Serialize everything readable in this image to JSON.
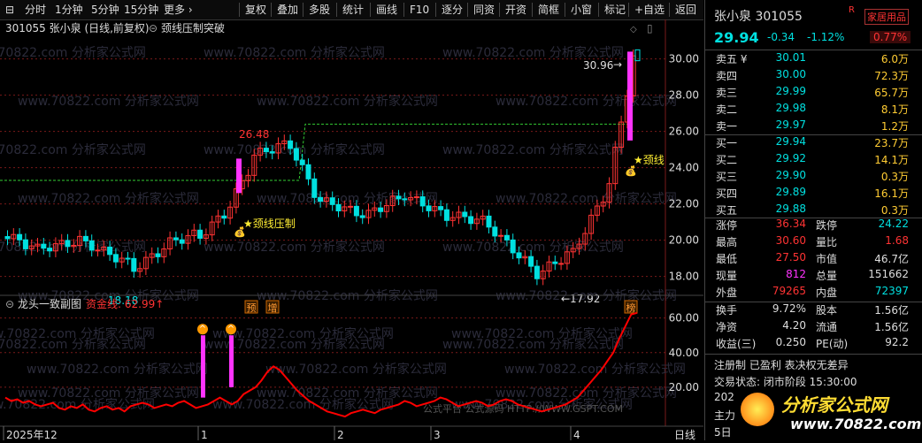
{
  "toolbar": {
    "left": [
      "分时",
      "1分钟",
      "5分钟",
      "15分钟",
      "更多 ›"
    ],
    "right": [
      "复权",
      "叠加",
      "多股",
      "统计",
      "画线",
      "F10",
      "逐分",
      "同资",
      "开资",
      "简框",
      "小窗",
      "标记",
      "+自选",
      "返回"
    ]
  },
  "main_chart": {
    "header": "301055 张小泉 (日线,前复权)",
    "indicator": "颈线压制突破",
    "watermark": "www.70822.com 分析家公式网",
    "y_ticks": [
      "30.00",
      "28.00",
      "26.00",
      "24.00",
      "22.00",
      "20.00",
      "18.00"
    ],
    "annotations": {
      "high_label": "26.48",
      "low_label": "18.18",
      "last_high": "30.96",
      "right_low": "←17.92",
      "tag1": "★颈线压制",
      "tag2": "★颈线"
    },
    "badges": [
      "预",
      "增",
      "榜"
    ]
  },
  "sub_chart": {
    "title": "龙头一致副图",
    "line_label": "资金线: 62.99↑",
    "y_ticks": [
      "60.00",
      "40.00",
      "20.00"
    ],
    "watermark": "公式平台  公式源码 HTTP://WWW.GSPT.COM"
  },
  "x_axis": {
    "labels": [
      "2025年12",
      "1",
      "2",
      "3",
      "4"
    ],
    "right_label": "日线"
  },
  "info": {
    "name": "张小泉 301055",
    "tag": "R",
    "sector": "家居用品",
    "price": "29.94",
    "change": "-0.34",
    "change_pct": "-1.12%",
    "turnover_pct_box": "0.77%",
    "asks": [
      {
        "label": "卖五 ¥",
        "price": "30.01",
        "vol": "6.0万"
      },
      {
        "label": "卖四",
        "price": "30.00",
        "vol": "72.3万"
      },
      {
        "label": "卖三",
        "price": "29.99",
        "vol": "65.7万"
      },
      {
        "label": "卖二",
        "price": "29.98",
        "vol": "8.1万"
      },
      {
        "label": "卖一",
        "price": "29.97",
        "vol": "1.2万"
      }
    ],
    "bids": [
      {
        "label": "买一",
        "price": "29.94",
        "vol": "23.7万"
      },
      {
        "label": "买二",
        "price": "29.92",
        "vol": "14.1万"
      },
      {
        "label": "买三",
        "price": "29.90",
        "vol": "0.3万"
      },
      {
        "label": "买四",
        "price": "29.89",
        "vol": "16.1万"
      },
      {
        "label": "买五",
        "price": "29.88",
        "vol": "0.3万"
      }
    ],
    "stats1": [
      {
        "l1": "涨停",
        "v1": "36.34",
        "c1": "r",
        "l2": "跌停",
        "v2": "24.22",
        "c2": "g"
      },
      {
        "l1": "最高",
        "v1": "30.60",
        "c1": "r",
        "l2": "量比",
        "v2": "1.68",
        "c2": "r"
      },
      {
        "l1": "最低",
        "v1": "27.50",
        "c1": "r",
        "l2": "市值",
        "v2": "46.7亿",
        "c2": "w"
      },
      {
        "l1": "现量",
        "v1": "812",
        "c1": "m",
        "l2": "总量",
        "v2": "151662",
        "c2": "w"
      },
      {
        "l1": "外盘",
        "v1": "79265",
        "c1": "r",
        "l2": "内盘",
        "v2": "72397",
        "c2": "g"
      }
    ],
    "stats2": [
      {
        "l1": "换手",
        "v1": "9.72%",
        "l2": "股本",
        "v2": "1.56亿"
      },
      {
        "l1": "净资",
        "v1": "4.20",
        "l2": "流通",
        "v2": "1.56亿"
      },
      {
        "l1": "收益(三)",
        "v1": "0.250",
        "l2": "PE(动)",
        "v2": "92.2"
      }
    ],
    "notes": [
      "注册制 已盈利 表决权无差异",
      "交易状态: 闭市阶段 15:30:00",
      "202",
      "主力",
      "5日"
    ],
    "logo_text": "分析家公式网",
    "logo_url": "www.70822.com"
  },
  "colors": {
    "up": "#ff3333",
    "down": "#00e0e0",
    "pink": "#ff33ff",
    "line": "#ff0000",
    "dashed": "#33cc33",
    "grid": "#7a1a1a"
  }
}
